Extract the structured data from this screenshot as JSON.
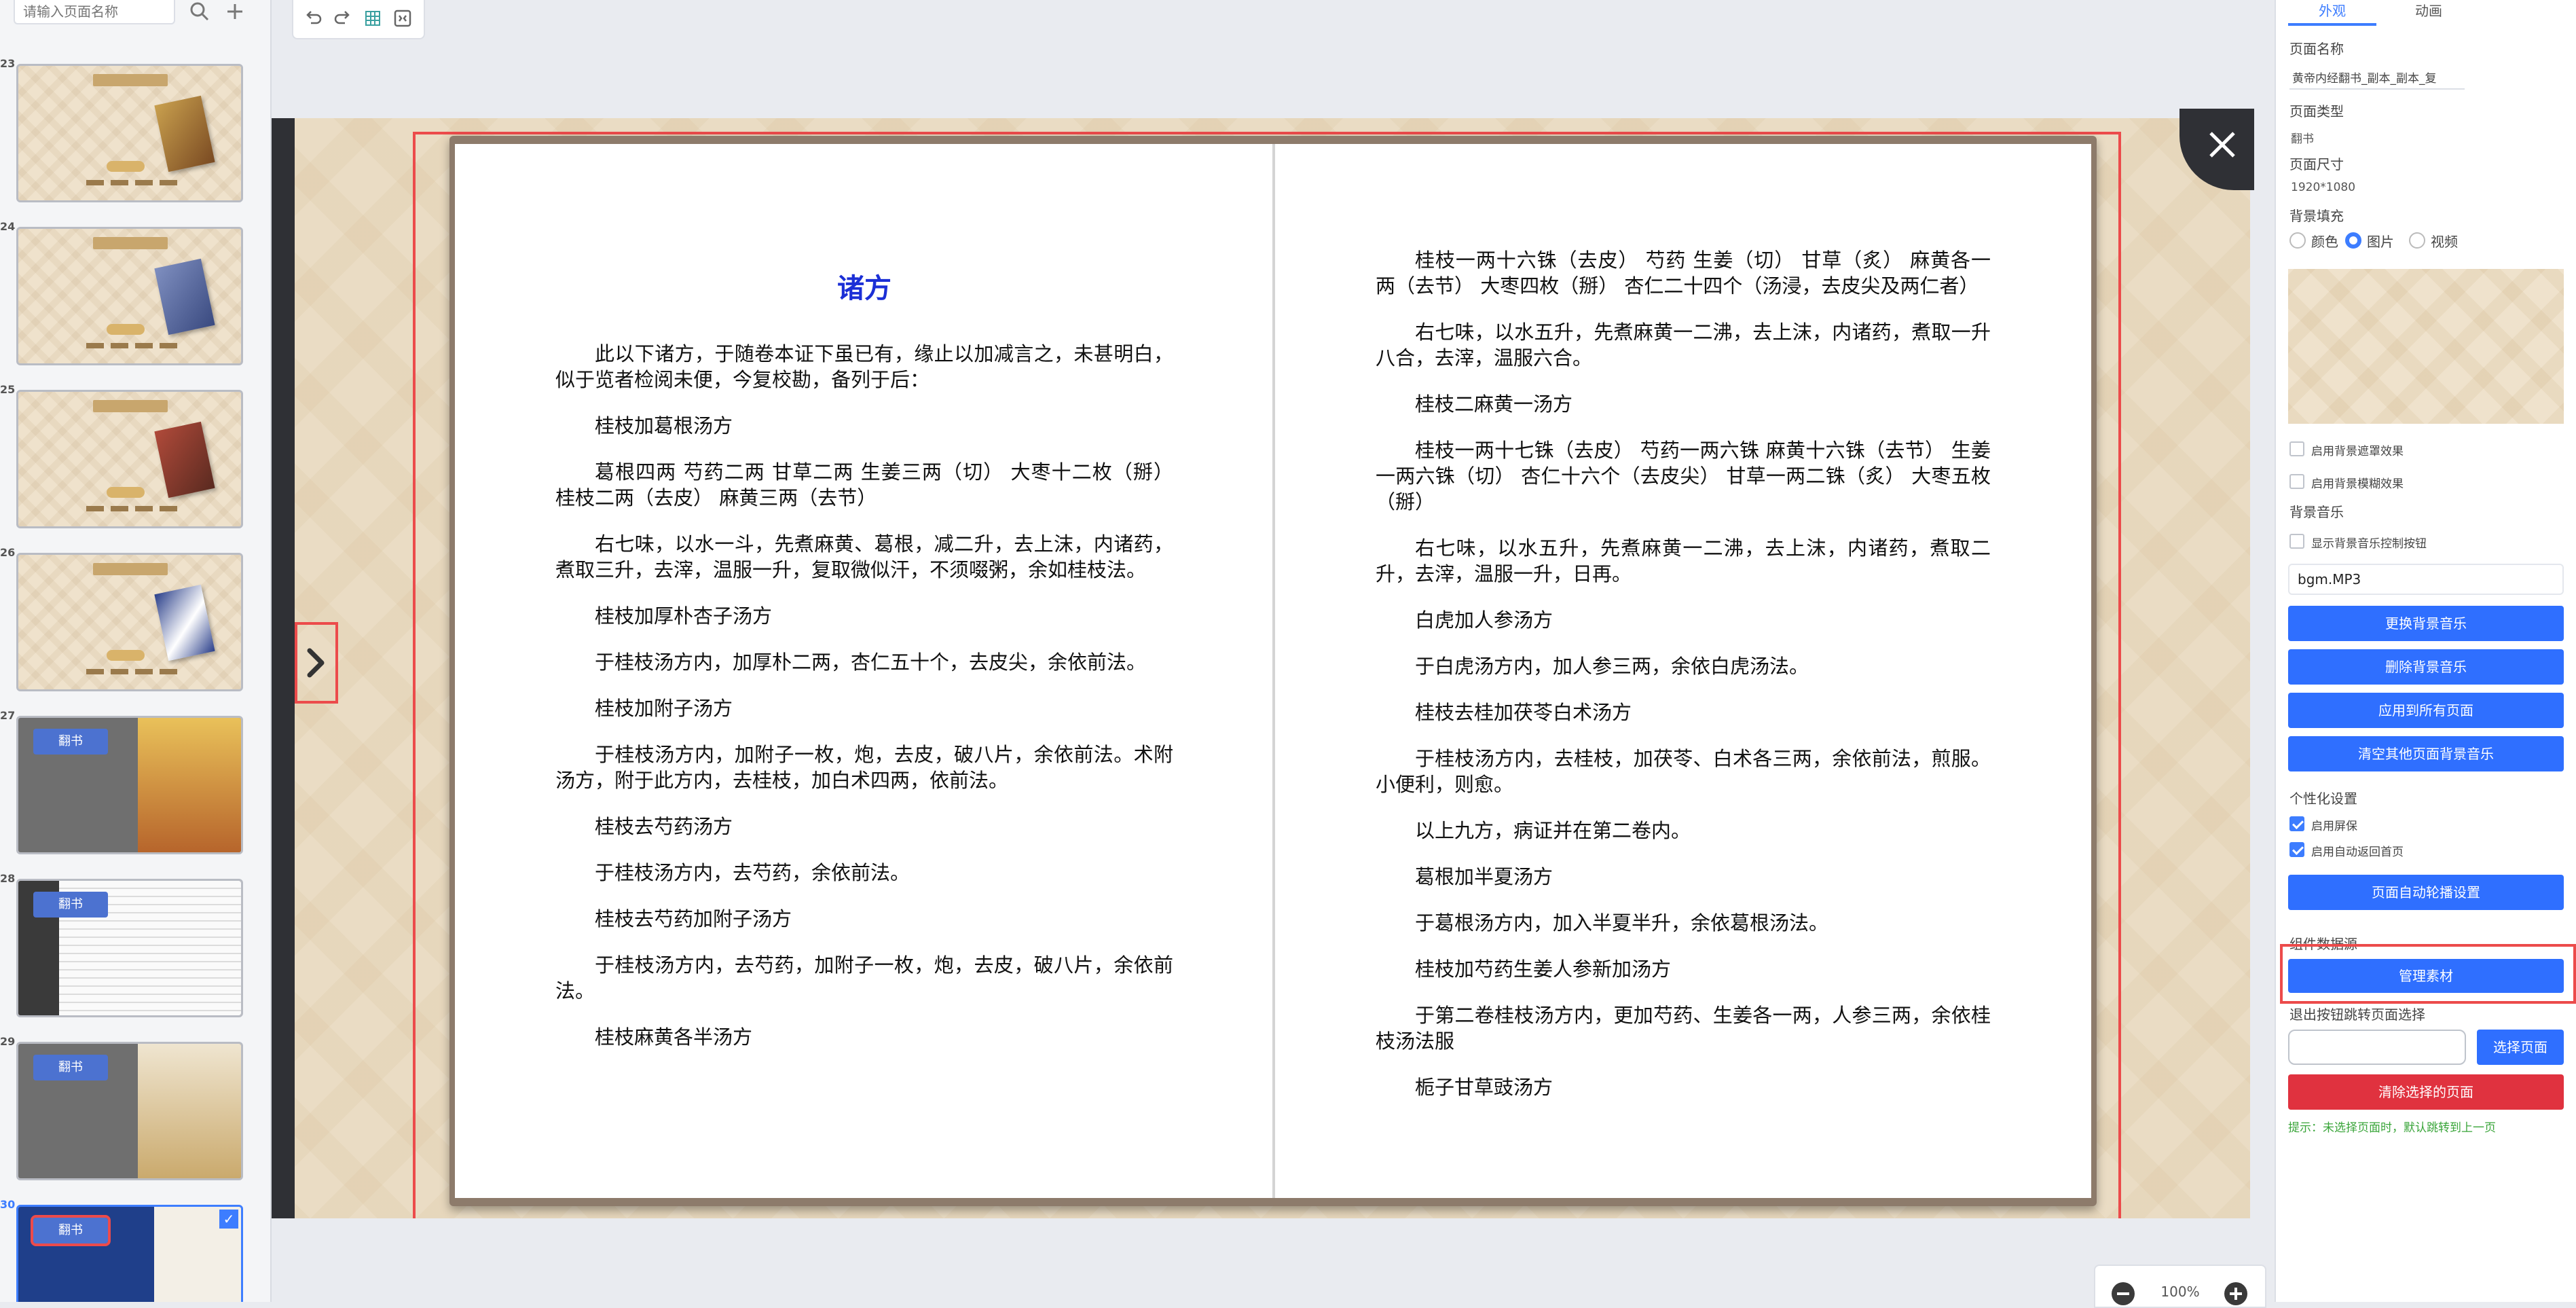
{
  "left_panel": {
    "search_placeholder": "请输入页面名称",
    "thumbnails": [
      {
        "num": "23",
        "badge": ""
      },
      {
        "num": "24",
        "badge": ""
      },
      {
        "num": "25",
        "badge": ""
      },
      {
        "num": "26",
        "badge": ""
      },
      {
        "num": "27",
        "badge": "翻书"
      },
      {
        "num": "28",
        "badge": "翻书"
      },
      {
        "num": "29",
        "badge": "翻书"
      },
      {
        "num": "30",
        "badge": "翻书"
      }
    ]
  },
  "toolbar": {
    "icons": [
      "undo-icon",
      "redo-icon",
      "grid-icon",
      "fit-screen-icon"
    ]
  },
  "book": {
    "left_page": {
      "title": "诸方",
      "paragraphs": [
        "此以下诸方，于随卷本证下虽已有，缘止以加减言之，未甚明白，似于览者检阅未便，今复校勘，备列于后：",
        "桂枝加葛根汤方",
        "葛根四两 芍药二两 甘草二两 生姜三两（切） 大枣十二枚（掰） 桂枝二两（去皮） 麻黄三两（去节）",
        "右七味，以水一斗，先煮麻黄、葛根，减二升，去上沫，内诸药，煮取三升，去滓，温服一升，复取微似汗，不须啜粥，余如桂枝法。",
        "桂枝加厚朴杏子汤方",
        "于桂枝汤方内，加厚朴二两，杏仁五十个，去皮尖，余依前法。",
        "桂枝加附子汤方",
        "于桂枝汤方内，加附子一枚，炮，去皮，破八片，余依前法。术附汤方，附于此方内，去桂枝，加白术四两，依前法。",
        "桂枝去芍药汤方",
        "于桂枝汤方内，去芍药，余依前法。",
        "桂枝去芍药加附子汤方",
        "于桂枝汤方内，去芍药，加附子一枚，炮，去皮，破八片，余依前法。",
        "桂枝麻黄各半汤方"
      ]
    },
    "right_page": {
      "paragraphs": [
        "桂枝一两十六铢（去皮） 芍药 生姜（切） 甘草（炙） 麻黄各一两（去节） 大枣四枚（掰） 杏仁二十四个（汤浸，去皮尖及两仁者）",
        "右七味，以水五升，先煮麻黄一二沸，去上沫，内诸药，煮取一升八合，去滓，温服六合。",
        "桂枝二麻黄一汤方",
        "桂枝一两十七铢（去皮） 芍药一两六铢 麻黄十六铢（去节） 生姜一两六铢（切） 杏仁十六个（去皮尖） 甘草一两二铢（炙） 大枣五枚（掰）",
        "右七味，以水五升，先煮麻黄一二沸，去上沫，内诸药，煮取二升，去滓，温服一升，日再。",
        "白虎加人参汤方",
        "于白虎汤方内，加人参三两，余依白虎汤法。",
        "桂枝去桂加茯苓白术汤方",
        "于桂枝汤方内，去桂枝，加茯苓、白术各三两，余依前法，煎服。小便利，则愈。",
        "以上九方，病证并在第二卷内。",
        "葛根加半夏汤方",
        "于葛根汤方内，加入半夏半升，余依葛根汤法。",
        "桂枝加芍药生姜人参新加汤方",
        "于第二卷桂枝汤方内，更加芍药、生姜各一两，人参三两，余依桂枝汤法服",
        "栀子甘草豉汤方"
      ]
    }
  },
  "zoom": {
    "label": "100%"
  },
  "right_panel": {
    "tabs": [
      "外观",
      "动画"
    ],
    "page_name_label": "页面名称",
    "page_name_value": "黄帝内经翻书_副本_副本_复",
    "page_type_label": "页面类型",
    "page_type_value": "翻书",
    "page_size_label": "页面尺寸",
    "page_size_value": "1920*1080",
    "bg_fill_label": "背景填充",
    "bg_fill_options": [
      "颜色",
      "图片",
      "视频"
    ],
    "bg_fill_selected": "图片",
    "enable_bg_mask": "启用背景遮罩效果",
    "enable_bg_blur": "启用背景模糊效果",
    "bg_music_label": "背景音乐",
    "show_music_control": "显示背景音乐控制按钮",
    "music_file": "bgm.MP3",
    "replace_music": "更换背景音乐",
    "delete_music": "删除背景音乐",
    "apply_all": "应用到所有页面",
    "clear_other_music": "清空其他页面背景音乐",
    "personalize_label": "个性化设置",
    "enable_screensaver": "启用屏保",
    "enable_auto_home": "启用自动返回首页",
    "autoplay_settings": "页面自动轮播设置",
    "component_data_label": "组件数据源",
    "manage_assets": "管理素材",
    "exit_jump_label": "退出按钮跳转页面选择",
    "select_page": "选择页面",
    "clear_selected_page": "清除选择的页面",
    "hint": "提示：未选择页面时，默认跳转到上一页"
  },
  "colors": {
    "accent": "#2f6fff",
    "danger": "#e0323f",
    "title_blue": "#1b2fd6",
    "highlight_red": "#ec4b4b"
  }
}
